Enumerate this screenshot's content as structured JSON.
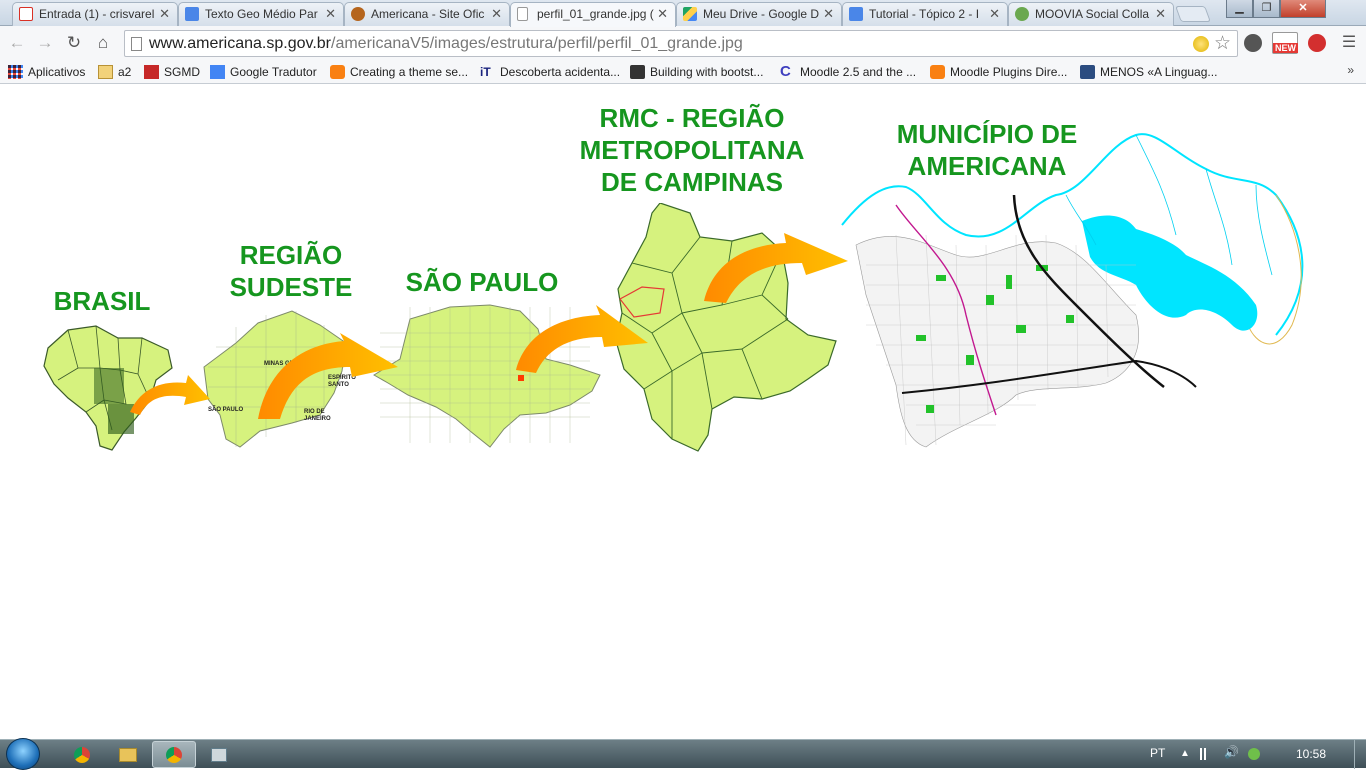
{
  "tabs": [
    {
      "label": "Entrada (1) - crisvarel",
      "icon": "gmail-icon",
      "color": "#d93025"
    },
    {
      "label": "Texto Geo Médio Par",
      "icon": "docs-icon",
      "color": "#4a86e8"
    },
    {
      "label": "Americana - Site Ofic",
      "icon": "americana-icon",
      "color": "#b5651d"
    },
    {
      "label": "perfil_01_grande.jpg (",
      "icon": "page-icon",
      "color": "#ffffff"
    },
    {
      "label": "Meu Drive - Google D",
      "icon": "drive-icon",
      "color": "#1fa463"
    },
    {
      "label": "Tutorial - Tópico 2 - I",
      "icon": "docs-icon",
      "color": "#4a86e8"
    },
    {
      "label": "MOOVIA Social Colla",
      "icon": "moovia-icon",
      "color": "#6aa84f"
    }
  ],
  "window_controls": {
    "minimize": "▁",
    "maximize": "❐",
    "close": "✕"
  },
  "toolbar": {
    "url_host": "www.americana.sp.gov.br",
    "url_path": "/americanaV5/images/estrutura/perfil/perfil_01_grande.jpg",
    "new_badge": "NEW"
  },
  "bookmarks": [
    {
      "label": "Aplicativos",
      "icon": "apps-grid-icon",
      "color": "#e8453c"
    },
    {
      "label": "a2",
      "icon": "folder-icon",
      "color": "#e0b84f"
    },
    {
      "label": "SGMD",
      "icon": "sgmd-icon",
      "color": "#c62828"
    },
    {
      "label": "Google Tradutor",
      "icon": "translate-icon",
      "color": "#4285f4"
    },
    {
      "label": "Creating a theme se...",
      "icon": "moodle-icon",
      "color": "#f98012"
    },
    {
      "label": "Descoberta acidenta...",
      "icon": "it-icon",
      "color": "#1a237e"
    },
    {
      "label": "Building with bootst...",
      "icon": "bootstrap-icon",
      "color": "#333333"
    },
    {
      "label": "Moodle 2.5 and the ...",
      "icon": "c-icon",
      "color": "#3f3fbf"
    },
    {
      "label": "Moodle Plugins Dire...",
      "icon": "moodle-icon",
      "color": "#f98012"
    },
    {
      "label": "MENOS «A Linguag...",
      "icon": "less-icon",
      "color": "#2b4c80"
    }
  ],
  "bookmarks_more": "»",
  "stages": [
    {
      "title": "BRASIL"
    },
    {
      "title": "REGIÃO\nSUDESTE"
    },
    {
      "title": "SÃO PAULO"
    },
    {
      "title": "RMC - REGIÃO\nMETROPOLITANA\nDE CAMPINAS"
    },
    {
      "title": "MUNICÍPIO DE\nAMERICANA"
    }
  ],
  "map_labels": {
    "sudeste": [
      "MINAS GERAIS",
      "ESPÍRITO\nSANTO",
      "SÃO PAULO",
      "RIO DE\nJANEIRO"
    ]
  },
  "colors": {
    "title_green": "#16961f",
    "map_fill": "#d6f27e",
    "map_stroke": "#7d8a6a",
    "arrow_orange": "#ff8a00",
    "arrow_yellow": "#ffc000",
    "water_cyan": "#00e5ff"
  },
  "taskbar": {
    "lang": "PT",
    "clock": "10:58"
  }
}
